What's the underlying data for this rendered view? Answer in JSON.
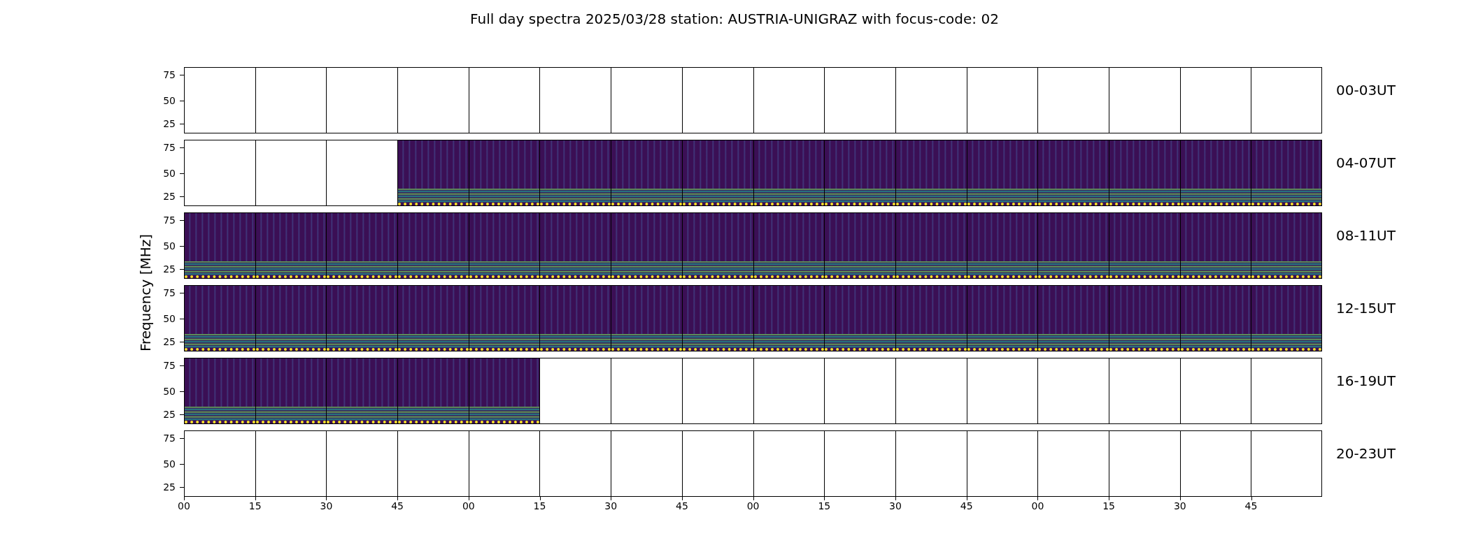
{
  "title": "Full day spectra 2025/03/28 station: AUSTRIA-UNIGRAZ with focus-code: 02",
  "ylabel": "Frequency [MHz]",
  "rows": [
    {
      "label": "00-03UT",
      "yticks": [
        "75",
        "50",
        "25"
      ],
      "panels": [
        false,
        false,
        false,
        false,
        false,
        false,
        false,
        false,
        false,
        false,
        false,
        false,
        false,
        false,
        false,
        false
      ]
    },
    {
      "label": "04-07UT",
      "yticks": [
        "75",
        "50",
        "25"
      ],
      "panels": [
        false,
        false,
        false,
        true,
        true,
        true,
        true,
        true,
        true,
        true,
        true,
        true,
        true,
        true,
        true,
        true
      ]
    },
    {
      "label": "08-11UT",
      "yticks": [
        "75",
        "50",
        "25"
      ],
      "panels": [
        true,
        true,
        true,
        true,
        true,
        true,
        true,
        true,
        true,
        true,
        true,
        true,
        true,
        true,
        true,
        true
      ]
    },
    {
      "label": "12-15UT",
      "yticks": [
        "75",
        "50",
        "25"
      ],
      "panels": [
        true,
        true,
        true,
        true,
        true,
        true,
        true,
        true,
        true,
        true,
        true,
        true,
        true,
        true,
        true,
        true
      ]
    },
    {
      "label": "16-19UT",
      "yticks": [
        "75",
        "50",
        "25"
      ],
      "panels": [
        true,
        true,
        true,
        true,
        true,
        false,
        false,
        false,
        false,
        false,
        false,
        false,
        false,
        false,
        false,
        false
      ]
    },
    {
      "label": "20-23UT",
      "yticks": [
        "75",
        "50",
        "25"
      ],
      "panels": [
        false,
        false,
        false,
        false,
        false,
        false,
        false,
        false,
        false,
        false,
        false,
        false,
        false,
        false,
        false,
        false
      ]
    }
  ],
  "xticks": [
    "00",
    "15",
    "30",
    "45",
    "00",
    "15",
    "30",
    "45",
    "00",
    "15",
    "30",
    "45",
    "00",
    "15",
    "30",
    "45"
  ]
}
